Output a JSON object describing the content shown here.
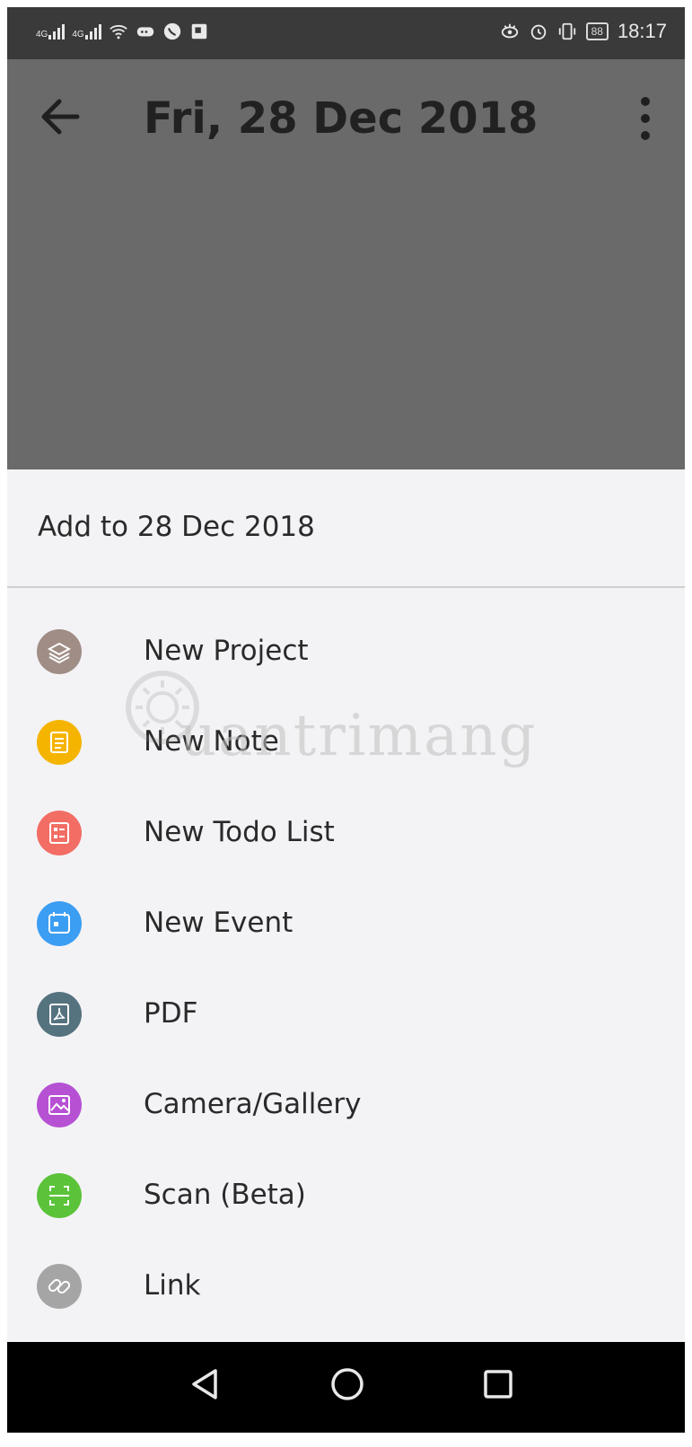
{
  "status_bar": {
    "time": "18:17",
    "battery_level": "88",
    "icons": [
      "signal-icon",
      "signal-icon",
      "wifi-icon",
      "messenger-icon",
      "whatsapp-icon",
      "gallery-icon",
      "eye-icon",
      "alarm-icon",
      "vibrate-icon",
      "battery-icon"
    ]
  },
  "header": {
    "title": "Fri, 28 Dec 2018",
    "back_icon": "arrow-left-icon",
    "menu_icon": "more-vertical-icon"
  },
  "sheet": {
    "title": "Add to 28 Dec 2018",
    "options": [
      {
        "label": "New Project",
        "icon": "layers-icon",
        "color": "#a08d86"
      },
      {
        "label": "New Note",
        "icon": "note-icon",
        "color": "#f5b400"
      },
      {
        "label": "New Todo List",
        "icon": "checklist-icon",
        "color": "#f26d64"
      },
      {
        "label": "New Event",
        "icon": "calendar-icon",
        "color": "#3c9ef2"
      },
      {
        "label": "PDF",
        "icon": "pdf-icon",
        "color": "#55727f"
      },
      {
        "label": "Camera/Gallery",
        "icon": "image-icon",
        "color": "#b651d4"
      },
      {
        "label": "Scan (Beta)",
        "icon": "scan-icon",
        "color": "#5bc33a"
      },
      {
        "label": "Link",
        "icon": "link-icon",
        "color": "#a5a5a5"
      }
    ]
  },
  "watermark": {
    "text": "uantrimang"
  },
  "nav_bar": {
    "icons": [
      "back-triangle-icon",
      "home-circle-icon",
      "recents-square-icon"
    ]
  },
  "colors": {
    "status_bar": "#3a3a3a",
    "dim_overlay": "#6a6a6a",
    "sheet_bg": "#f3f3f6",
    "nav_bar": "#000000"
  }
}
